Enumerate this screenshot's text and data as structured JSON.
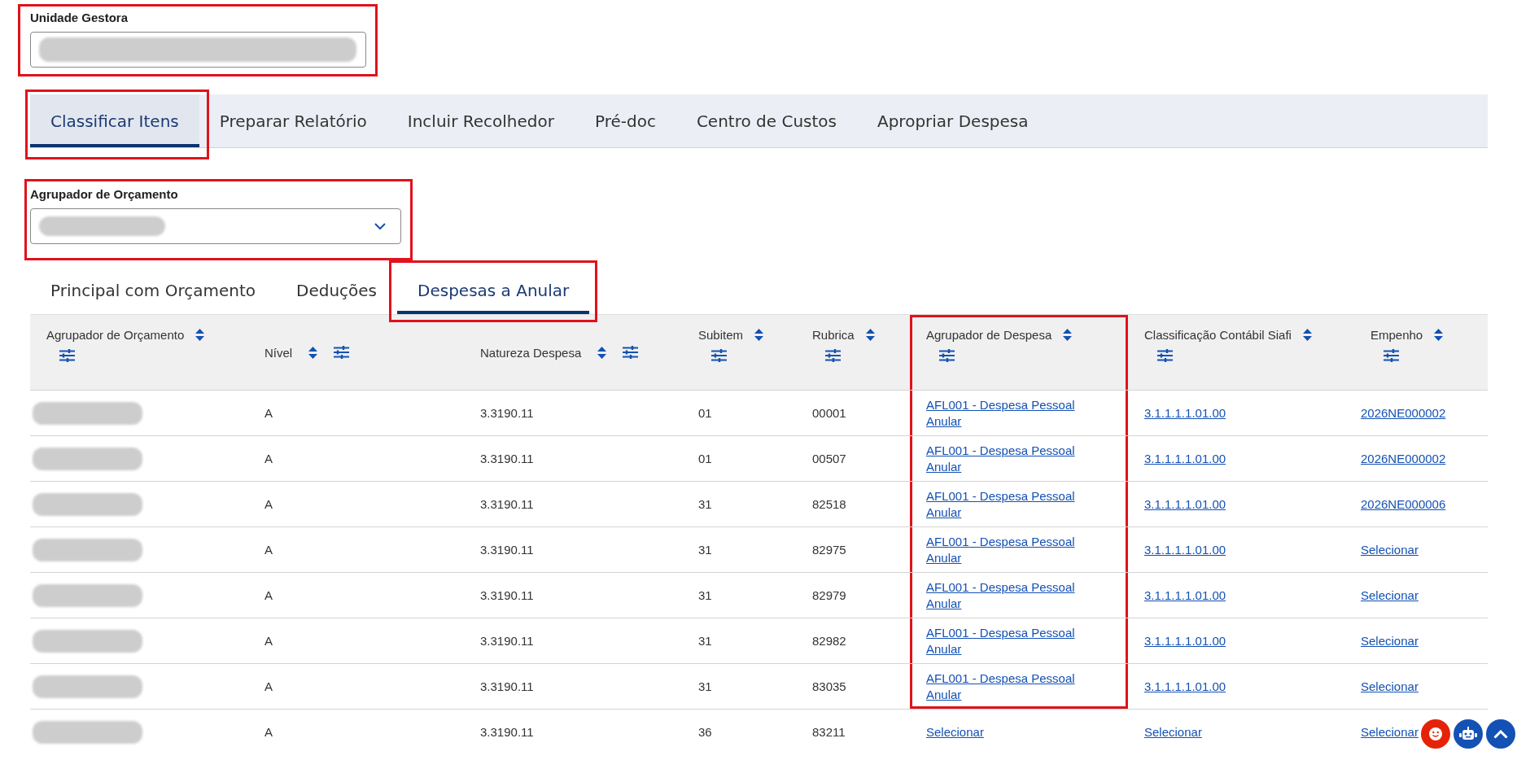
{
  "unit_field": {
    "label": "Unidade Gestora",
    "value_blurred": true,
    "highlighted": true
  },
  "main_tabs": [
    {
      "label": "Classificar Itens",
      "selected": true,
      "highlighted": true
    },
    {
      "label": "Preparar Relatório",
      "selected": false,
      "highlighted": false
    },
    {
      "label": "Incluir Recolhedor",
      "selected": false,
      "highlighted": false
    },
    {
      "label": "Pré-doc",
      "selected": false,
      "highlighted": false
    },
    {
      "label": "Centro de Custos",
      "selected": false,
      "highlighted": false
    },
    {
      "label": "Apropriar Despesa",
      "selected": false,
      "highlighted": false
    }
  ],
  "budget_group_field": {
    "label": "Agrupador de Orçamento",
    "value_blurred": true,
    "highlighted": true
  },
  "sub_tabs": [
    {
      "label": "Principal com Orçamento",
      "selected": false,
      "highlighted": false
    },
    {
      "label": "Deduções",
      "selected": false,
      "highlighted": false
    },
    {
      "label": "Despesas a Anular",
      "selected": true,
      "highlighted": true
    }
  ],
  "table": {
    "columns": [
      {
        "label": "Agrupador de Orçamento",
        "kind": "stacked",
        "highlighted": false
      },
      {
        "label": "Nível",
        "kind": "inline",
        "highlighted": false
      },
      {
        "label": "Natureza Despesa",
        "kind": "inline",
        "highlighted": false
      },
      {
        "label": "Subitem",
        "kind": "stacked",
        "highlighted": false
      },
      {
        "label": "Rubrica",
        "kind": "stacked",
        "highlighted": false
      },
      {
        "label": "Agrupador de Despesa",
        "kind": "stacked",
        "highlighted": true
      },
      {
        "label": "Classificação Contábil Siafi",
        "kind": "stacked",
        "highlighted": false
      },
      {
        "label": "Empenho",
        "kind": "stacked",
        "highlighted": false
      }
    ],
    "rows": [
      {
        "cells": [
          {
            "kind": "blurred"
          },
          {
            "kind": "text",
            "text": "A"
          },
          {
            "kind": "text",
            "text": "3.3190.11"
          },
          {
            "kind": "text",
            "text": "01"
          },
          {
            "kind": "text",
            "text": "00001"
          },
          {
            "kind": "link",
            "text": "AFL001 - Despesa Pessoal Anular"
          },
          {
            "kind": "link",
            "text": "3.1.1.1.1.01.00"
          },
          {
            "kind": "link",
            "text": "2026NE000002"
          }
        ]
      },
      {
        "cells": [
          {
            "kind": "blurred"
          },
          {
            "kind": "text",
            "text": "A"
          },
          {
            "kind": "text",
            "text": "3.3190.11"
          },
          {
            "kind": "text",
            "text": "01"
          },
          {
            "kind": "text",
            "text": "00507"
          },
          {
            "kind": "link",
            "text": "AFL001 - Despesa Pessoal Anular"
          },
          {
            "kind": "link",
            "text": "3.1.1.1.1.01.00"
          },
          {
            "kind": "link",
            "text": "2026NE000002"
          }
        ]
      },
      {
        "cells": [
          {
            "kind": "blurred"
          },
          {
            "kind": "text",
            "text": "A"
          },
          {
            "kind": "text",
            "text": "3.3190.11"
          },
          {
            "kind": "text",
            "text": "31"
          },
          {
            "kind": "text",
            "text": "82518"
          },
          {
            "kind": "link",
            "text": "AFL001 - Despesa Pessoal Anular"
          },
          {
            "kind": "link",
            "text": "3.1.1.1.1.01.00"
          },
          {
            "kind": "link",
            "text": "2026NE000006"
          }
        ]
      },
      {
        "cells": [
          {
            "kind": "blurred"
          },
          {
            "kind": "text",
            "text": "A"
          },
          {
            "kind": "text",
            "text": "3.3190.11"
          },
          {
            "kind": "text",
            "text": "31"
          },
          {
            "kind": "text",
            "text": "82975"
          },
          {
            "kind": "link",
            "text": "AFL001 - Despesa Pessoal Anular"
          },
          {
            "kind": "link",
            "text": "3.1.1.1.1.01.00"
          },
          {
            "kind": "link",
            "text": "Selecionar"
          }
        ]
      },
      {
        "cells": [
          {
            "kind": "blurred"
          },
          {
            "kind": "text",
            "text": "A"
          },
          {
            "kind": "text",
            "text": "3.3190.11"
          },
          {
            "kind": "text",
            "text": "31"
          },
          {
            "kind": "text",
            "text": "82979"
          },
          {
            "kind": "link",
            "text": "AFL001 - Despesa Pessoal Anular"
          },
          {
            "kind": "link",
            "text": "3.1.1.1.1.01.00"
          },
          {
            "kind": "link",
            "text": "Selecionar"
          }
        ]
      },
      {
        "cells": [
          {
            "kind": "blurred"
          },
          {
            "kind": "text",
            "text": "A"
          },
          {
            "kind": "text",
            "text": "3.3190.11"
          },
          {
            "kind": "text",
            "text": "31"
          },
          {
            "kind": "text",
            "text": "82982"
          },
          {
            "kind": "link",
            "text": "AFL001 - Despesa Pessoal Anular"
          },
          {
            "kind": "link",
            "text": "3.1.1.1.1.01.00"
          },
          {
            "kind": "link",
            "text": "Selecionar"
          }
        ]
      },
      {
        "cells": [
          {
            "kind": "blurred"
          },
          {
            "kind": "text",
            "text": "A"
          },
          {
            "kind": "text",
            "text": "3.3190.11"
          },
          {
            "kind": "text",
            "text": "31"
          },
          {
            "kind": "text",
            "text": "83035"
          },
          {
            "kind": "link",
            "text": "AFL001 - Despesa Pessoal Anular"
          },
          {
            "kind": "link",
            "text": "3.1.1.1.1.01.00"
          },
          {
            "kind": "link",
            "text": "Selecionar"
          }
        ]
      },
      {
        "cells": [
          {
            "kind": "blurred"
          },
          {
            "kind": "text",
            "text": "A"
          },
          {
            "kind": "text",
            "text": "3.3190.11"
          },
          {
            "kind": "text",
            "text": "36"
          },
          {
            "kind": "text",
            "text": "83211"
          },
          {
            "kind": "link",
            "text": "Selecionar"
          },
          {
            "kind": "link",
            "text": "Selecionar"
          },
          {
            "kind": "link",
            "text": "Selecionar"
          }
        ]
      }
    ]
  }
}
